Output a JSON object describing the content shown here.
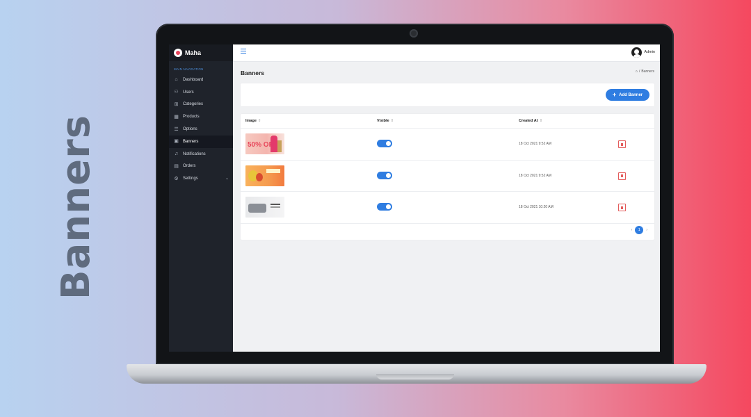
{
  "side_title": "Banners",
  "app": {
    "logo_text": "Maha",
    "nav_heading": "MAIN NAVIGATION",
    "nav_items": [
      {
        "label": "Dashboard",
        "icon": "home-icon"
      },
      {
        "label": "Users",
        "icon": "users-icon"
      },
      {
        "label": "Categories",
        "icon": "categories-icon"
      },
      {
        "label": "Products",
        "icon": "products-icon"
      },
      {
        "label": "Options",
        "icon": "options-icon"
      },
      {
        "label": "Banners",
        "icon": "banner-icon",
        "active": true
      },
      {
        "label": "Notifications",
        "icon": "bell-icon"
      },
      {
        "label": "Orders",
        "icon": "orders-icon"
      },
      {
        "label": "Settings",
        "icon": "gear-icon",
        "has_submenu": true
      }
    ],
    "topbar": {
      "admin_label": "Admin"
    },
    "page_title": "Banners",
    "breadcrumb": {
      "separator": "/",
      "current": "Banners"
    },
    "add_button_label": "Add Banner",
    "table": {
      "headers": [
        "Image",
        "Visible",
        "Created At"
      ],
      "rows": [
        {
          "banner_text": "50% OFF",
          "visible": true,
          "created_at": "18 Oct 2021 9:52 AM"
        },
        {
          "banner_text": "",
          "visible": true,
          "created_at": "18 Oct 2021 9:52 AM"
        },
        {
          "banner_text": "",
          "visible": true,
          "created_at": "18 Oct 2021 10:20 AM"
        }
      ]
    },
    "pagination": {
      "prev": "‹",
      "current": "1",
      "next": "›"
    },
    "colors": {
      "accent": "#2f7de1",
      "sidebar": "#1f232b",
      "danger": "#e35b5b"
    }
  }
}
